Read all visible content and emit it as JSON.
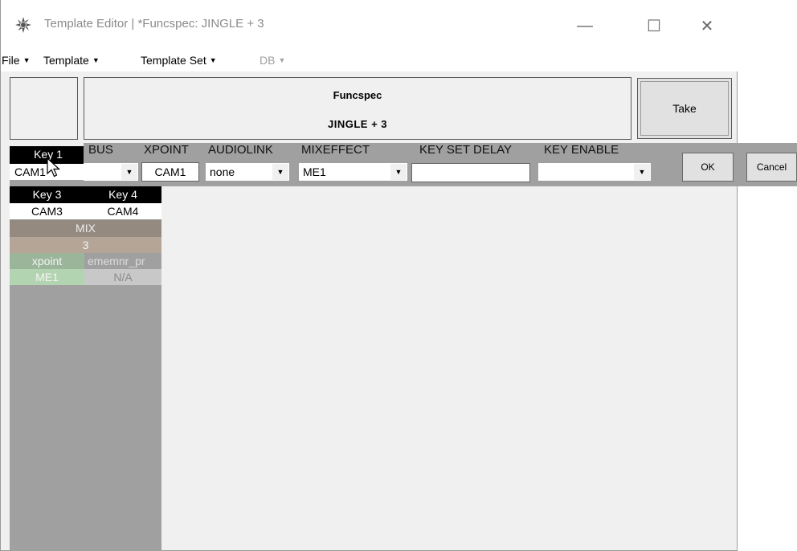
{
  "window": {
    "title": "Template Editor | *Funcspec: JINGLE + 3",
    "controls": {
      "minimize": "—",
      "maximize": "☐",
      "close": "✕"
    }
  },
  "menu": [
    {
      "label": "File",
      "disabled": false
    },
    {
      "label": "Template",
      "disabled": false
    },
    {
      "label": "Template Set",
      "disabled": false
    },
    {
      "label": "DB",
      "disabled": true
    }
  ],
  "header": {
    "line1": "Funcspec",
    "line2": "JINGLE + 3"
  },
  "take_button": "Take",
  "sidebar": {
    "key1": "Key 1",
    "key1_value": "CAM1",
    "key3": "Key 3",
    "key4": "Key 4",
    "key3_value": "CAM3",
    "key4_value": "CAM4",
    "mix_label": "MIX",
    "mix_value": "3",
    "xpoint_label": "xpoint",
    "ememnr_label": "ememnr_pr",
    "xpoint_value": "ME1",
    "ememnr_value": "N/A"
  },
  "editbar": {
    "headers": {
      "bus": "BUS",
      "xpoint": "XPOINT",
      "audiolink": "AUDIOLINK",
      "mixeffect": "MIXEFFECT",
      "key_set_delay": "KEY SET DELAY",
      "key_enable": "KEY ENABLE"
    },
    "values": {
      "bus": "",
      "xpoint": "CAM1",
      "audiolink": "none",
      "mixeffect": "ME1",
      "key_set_delay": "",
      "key_enable": ""
    },
    "ok": "OK",
    "cancel": "Cancel"
  },
  "colors": {
    "sidebar_bg": "#a0a0a0",
    "key_header_bg": "#000000",
    "mix_bg": "#958a80",
    "mix_value_bg": "#b5a596",
    "xpoint_bg": "#9bb59a",
    "me1_bg": "#b3d4b1",
    "na_bg": "#c8c8c8"
  }
}
